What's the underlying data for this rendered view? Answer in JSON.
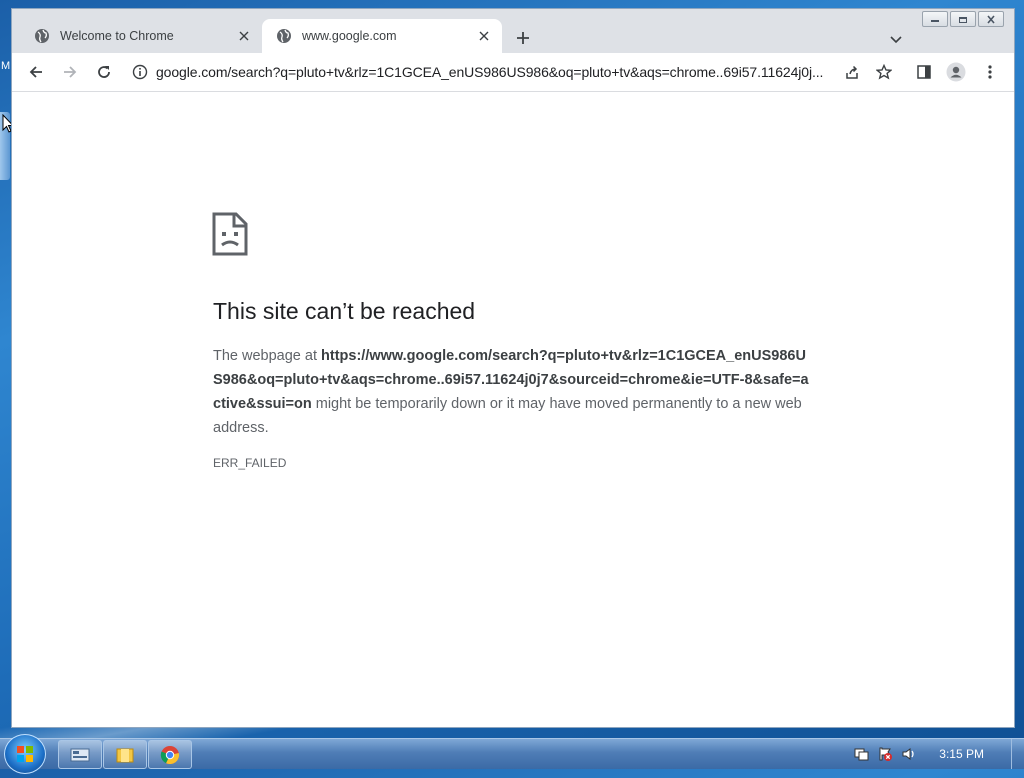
{
  "desktop": {
    "left_label": "M"
  },
  "tabs": [
    {
      "title": "Welcome to Chrome",
      "active": false
    },
    {
      "title": "www.google.com",
      "active": true
    }
  ],
  "omnibox": {
    "url": "google.com/search?q=pluto+tv&rlz=1C1GCEA_enUS986US986&oq=pluto+tv&aqs=chrome..69i57.11624j0j..."
  },
  "error": {
    "title": "This site can’t be reached",
    "desc_prefix": "The webpage at ",
    "desc_url": "https://www.google.com/search?q=pluto+tv&rlz=1C1GCEA_enUS986US986&oq=pluto+tv&aqs=chrome..69i57.11624j0j7&sourceid=chrome&ie=UTF-8&safe=active&ssui=on",
    "desc_suffix": " might be temporarily down or it may have moved permanently to a new web address.",
    "code": "ERR_FAILED"
  },
  "taskbar": {
    "clock": "3:15 PM"
  },
  "icons": {
    "tab_favicon": "globe-icon",
    "back": "back-arrow-icon",
    "forward": "forward-arrow-icon",
    "reload": "reload-icon",
    "site_info": "info-icon",
    "share": "share-icon",
    "bookmark": "star-icon",
    "side_panel": "side-panel-icon",
    "profile": "profile-icon",
    "menu": "kebab-menu-icon",
    "error": "sad-page-icon"
  }
}
